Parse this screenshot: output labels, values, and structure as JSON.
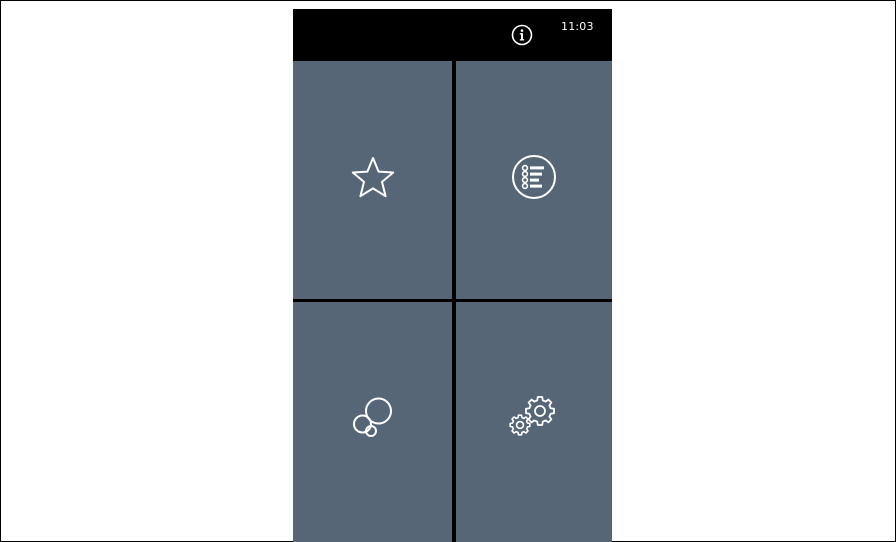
{
  "status_bar": {
    "time": "11:03",
    "info_icon": "info-circle-icon"
  },
  "tiles": [
    {
      "icon": "star-icon"
    },
    {
      "icon": "list-circle-icon"
    },
    {
      "icon": "bubbles-icon"
    },
    {
      "icon": "gears-icon"
    }
  ],
  "colors": {
    "tile_background": "#566676",
    "divider": "#000000",
    "status_bar": "#000000",
    "icon_stroke": "#ffffff"
  }
}
